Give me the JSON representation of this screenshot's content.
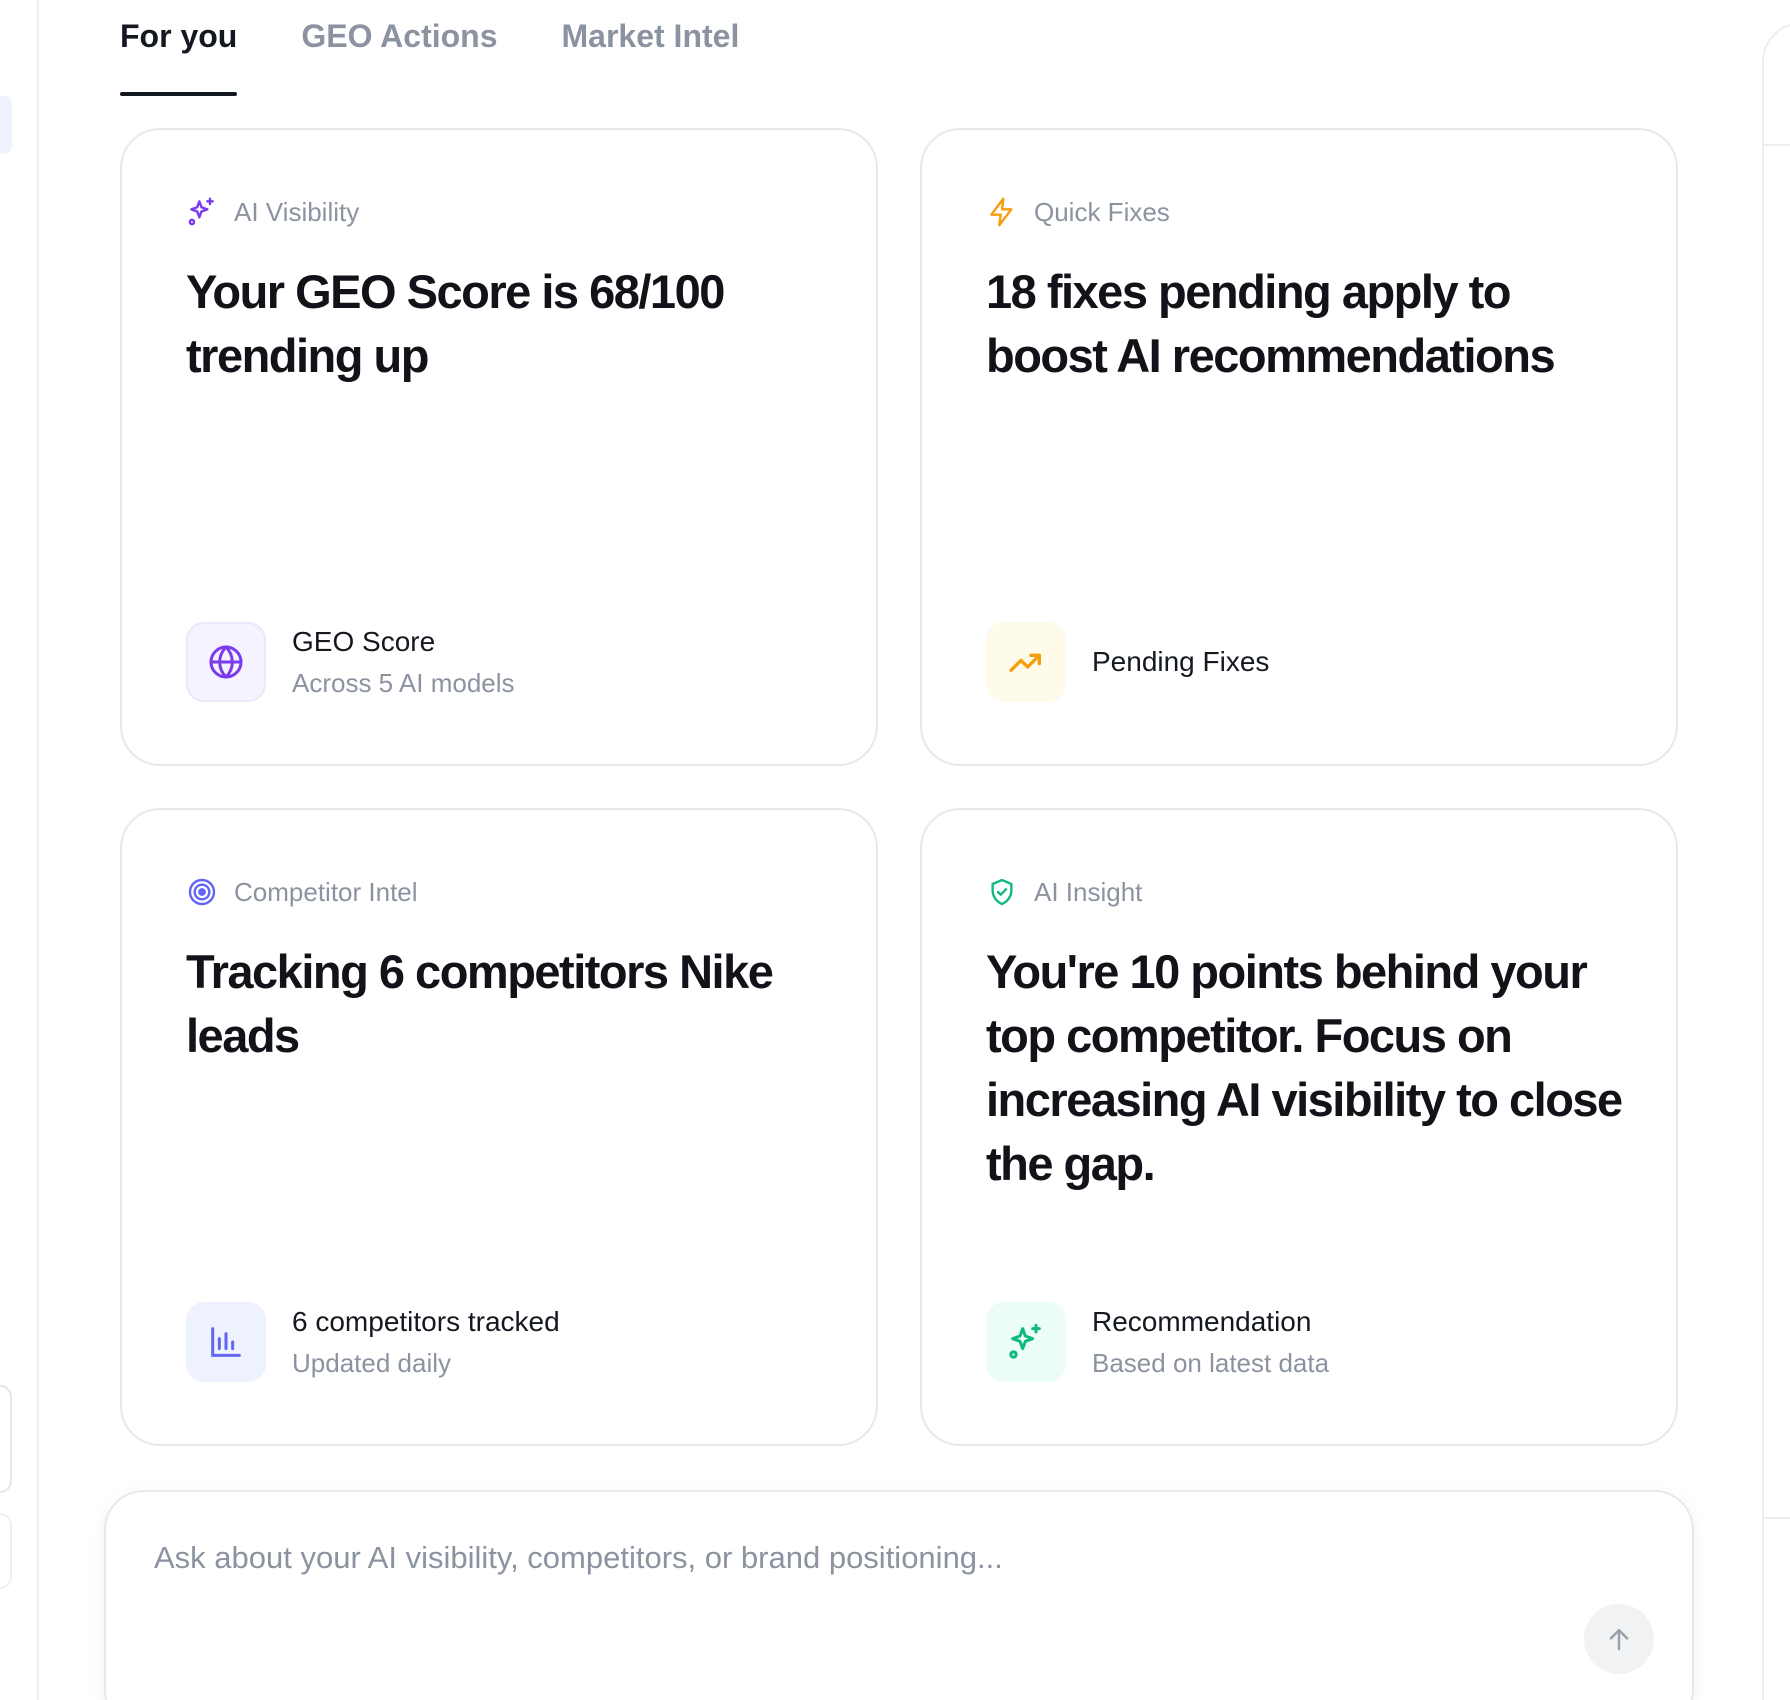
{
  "tabs": [
    {
      "label": "For you",
      "active": true
    },
    {
      "label": "GEO Actions",
      "active": false
    },
    {
      "label": "Market Intel",
      "active": false
    }
  ],
  "cards": [
    {
      "category": "AI Visibility",
      "category_icon": "sparkles-icon",
      "accent": "#7c3aed",
      "title": "Your GEO Score is 68/100 trending up",
      "footer_icon": "globe-icon",
      "footer_main": "GEO Score",
      "footer_sub": "Across 5 AI models"
    },
    {
      "category": "Quick Fixes",
      "category_icon": "lightning-icon",
      "accent": "#f59e0b",
      "title": "18 fixes pending apply to boost AI recommendations",
      "footer_icon": "trending-up-icon",
      "footer_main": "Pending Fixes",
      "footer_sub": ""
    },
    {
      "category": "Competitor Intel",
      "category_icon": "target-icon",
      "accent": "#6366f1",
      "title": "Tracking 6 competitors Nike leads",
      "footer_icon": "bar-chart-icon",
      "footer_main": "6 competitors tracked",
      "footer_sub": "Updated daily"
    },
    {
      "category": "AI Insight",
      "category_icon": "shield-check-icon",
      "accent": "#10b981",
      "title": "You're 10 points behind your top competitor. Focus on increasing AI visibility to close the gap.",
      "footer_icon": "sparkles-icon",
      "footer_main": "Recommendation",
      "footer_sub": "Based on latest data"
    }
  ],
  "ask": {
    "placeholder": "Ask about your AI visibility, competitors, or brand positioning...",
    "value": "",
    "send_icon": "arrow-up-icon"
  }
}
